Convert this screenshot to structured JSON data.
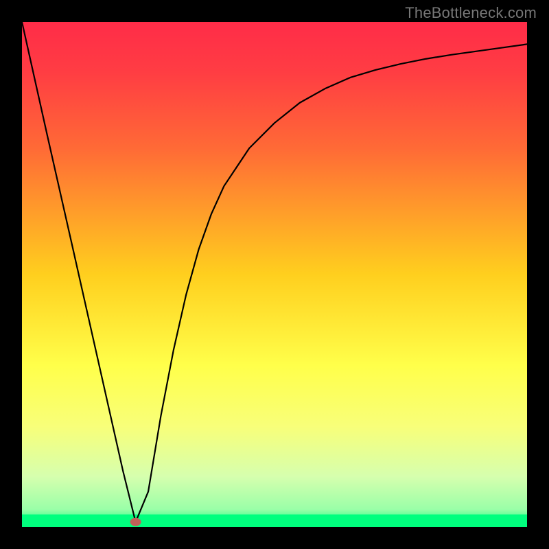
{
  "watermark": "TheBottleneck.com",
  "chart_data": {
    "type": "line",
    "title": "",
    "xlabel": "",
    "ylabel": "",
    "xlim": [
      0,
      100
    ],
    "ylim": [
      0,
      100
    ],
    "grid": false,
    "series": [
      {
        "name": "curve",
        "x": [
          0,
          5,
          10,
          15,
          20,
          22.5,
          25,
          27.5,
          30,
          32.5,
          35,
          37.5,
          40,
          45,
          50,
          55,
          60,
          65,
          70,
          75,
          80,
          85,
          90,
          95,
          100
        ],
        "values": [
          100,
          77.6,
          55.5,
          33.3,
          11.1,
          1.0,
          7.0,
          22.0,
          35.0,
          46.0,
          55.0,
          62.0,
          67.5,
          75.0,
          80.0,
          84.0,
          86.8,
          89.0,
          90.5,
          91.7,
          92.7,
          93.5,
          94.2,
          94.9,
          95.6
        ]
      }
    ],
    "marker": {
      "x": 22.5,
      "y": 1.0
    },
    "green_band": {
      "from_y": 0,
      "to_y": 2.5
    },
    "gradient_stops": [
      {
        "offset": 0.0,
        "color": "#ff2c48"
      },
      {
        "offset": 0.1,
        "color": "#ff3d43"
      },
      {
        "offset": 0.25,
        "color": "#ff6a36"
      },
      {
        "offset": 0.5,
        "color": "#ffcf1e"
      },
      {
        "offset": 0.68,
        "color": "#ffff4a"
      },
      {
        "offset": 0.8,
        "color": "#f8ff79"
      },
      {
        "offset": 0.9,
        "color": "#d6ffae"
      },
      {
        "offset": 0.965,
        "color": "#9affa8"
      },
      {
        "offset": 1.0,
        "color": "#00ff7e"
      }
    ]
  }
}
